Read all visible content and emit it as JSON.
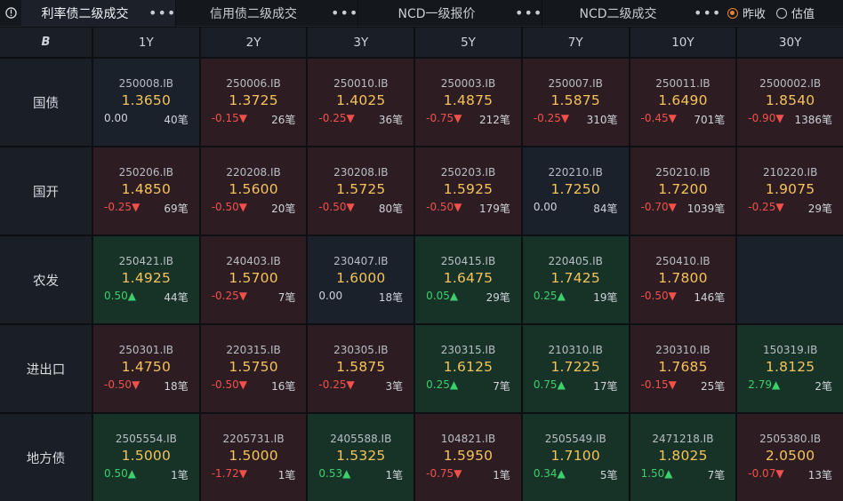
{
  "tabs": [
    {
      "label": "利率债二级成交",
      "active": true
    },
    {
      "label": "信用债二级成交",
      "active": false
    },
    {
      "label": "NCD一级报价",
      "active": false
    },
    {
      "label": "NCD二级成交",
      "active": false
    }
  ],
  "tab_menu_glyph": "•••",
  "radio": {
    "options": [
      {
        "label": "昨收",
        "checked": true
      },
      {
        "label": "估值",
        "checked": false
      }
    ]
  },
  "corner_icon": "B",
  "tenors": [
    "1Y",
    "2Y",
    "3Y",
    "5Y",
    "7Y",
    "10Y",
    "30Y"
  ],
  "rows": [
    {
      "label": "国债",
      "cells": [
        {
          "code": "250008.IB",
          "price": "1.3650",
          "change": "0.00",
          "trend": "neutral",
          "count": "40笔"
        },
        {
          "code": "250006.IB",
          "price": "1.3725",
          "change": "-0.15",
          "trend": "down",
          "count": "26笔"
        },
        {
          "code": "250010.IB",
          "price": "1.4025",
          "change": "-0.25",
          "trend": "down",
          "count": "36笔"
        },
        {
          "code": "250003.IB",
          "price": "1.4875",
          "change": "-0.75",
          "trend": "down",
          "count": "212笔"
        },
        {
          "code": "250007.IB",
          "price": "1.5875",
          "change": "-0.25",
          "trend": "down",
          "count": "310笔"
        },
        {
          "code": "250011.IB",
          "price": "1.6490",
          "change": "-0.45",
          "trend": "down",
          "count": "701笔"
        },
        {
          "code": "2500002.IB",
          "price": "1.8540",
          "change": "-0.90",
          "trend": "down",
          "count": "1386笔"
        }
      ]
    },
    {
      "label": "国开",
      "cells": [
        {
          "code": "250206.IB",
          "price": "1.4850",
          "change": "-0.25",
          "trend": "down",
          "count": "69笔"
        },
        {
          "code": "220208.IB",
          "price": "1.5600",
          "change": "-0.50",
          "trend": "down",
          "count": "20笔"
        },
        {
          "code": "230208.IB",
          "price": "1.5725",
          "change": "-0.50",
          "trend": "down",
          "count": "80笔"
        },
        {
          "code": "250203.IB",
          "price": "1.5925",
          "change": "-0.50",
          "trend": "down",
          "count": "179笔"
        },
        {
          "code": "220210.IB",
          "price": "1.7250",
          "change": "0.00",
          "trend": "neutral",
          "count": "84笔"
        },
        {
          "code": "250210.IB",
          "price": "1.7200",
          "change": "-0.70",
          "trend": "down",
          "count": "1039笔"
        },
        {
          "code": "210220.IB",
          "price": "1.9075",
          "change": "-0.25",
          "trend": "down",
          "count": "29笔"
        }
      ]
    },
    {
      "label": "农发",
      "cells": [
        {
          "code": "250421.IB",
          "price": "1.4925",
          "change": "0.50",
          "trend": "up",
          "count": "44笔"
        },
        {
          "code": "240403.IB",
          "price": "1.5700",
          "change": "-0.25",
          "trend": "down",
          "count": "7笔"
        },
        {
          "code": "230407.IB",
          "price": "1.6000",
          "change": "0.00",
          "trend": "neutral",
          "count": "18笔"
        },
        {
          "code": "250415.IB",
          "price": "1.6475",
          "change": "0.05",
          "trend": "up",
          "count": "29笔"
        },
        {
          "code": "220405.IB",
          "price": "1.7425",
          "change": "0.25",
          "trend": "up",
          "count": "19笔"
        },
        {
          "code": "250410.IB",
          "price": "1.7800",
          "change": "-0.50",
          "trend": "down",
          "count": "146笔"
        },
        null
      ]
    },
    {
      "label": "进出口",
      "cells": [
        {
          "code": "250301.IB",
          "price": "1.4750",
          "change": "-0.50",
          "trend": "down",
          "count": "18笔"
        },
        {
          "code": "220315.IB",
          "price": "1.5750",
          "change": "-0.50",
          "trend": "down",
          "count": "16笔"
        },
        {
          "code": "230305.IB",
          "price": "1.5875",
          "change": "-0.25",
          "trend": "down",
          "count": "3笔"
        },
        {
          "code": "230315.IB",
          "price": "1.6125",
          "change": "0.25",
          "trend": "up",
          "count": "7笔"
        },
        {
          "code": "210310.IB",
          "price": "1.7225",
          "change": "0.75",
          "trend": "up",
          "count": "17笔"
        },
        {
          "code": "230310.IB",
          "price": "1.7685",
          "change": "-0.15",
          "trend": "down",
          "count": "25笔"
        },
        {
          "code": "150319.IB",
          "price": "1.8125",
          "change": "2.79",
          "trend": "up",
          "count": "2笔"
        }
      ]
    },
    {
      "label": "地方债",
      "cells": [
        {
          "code": "2505554.IB",
          "price": "1.5000",
          "change": "0.50",
          "trend": "up",
          "count": "1笔"
        },
        {
          "code": "2205731.IB",
          "price": "1.5000",
          "change": "-1.72",
          "trend": "down",
          "count": "1笔"
        },
        {
          "code": "2405588.IB",
          "price": "1.5325",
          "change": "0.53",
          "trend": "up",
          "count": "1笔"
        },
        {
          "code": "104821.IB",
          "price": "1.5950",
          "change": "-0.75",
          "trend": "down",
          "count": "1笔"
        },
        {
          "code": "2505549.IB",
          "price": "1.7100",
          "change": "0.34",
          "trend": "up",
          "count": "5笔"
        },
        {
          "code": "2471218.IB",
          "price": "1.8025",
          "change": "1.50",
          "trend": "up",
          "count": "7笔"
        },
        {
          "code": "2505380.IB",
          "price": "2.0500",
          "change": "-0.07",
          "trend": "down",
          "count": "13笔"
        }
      ]
    }
  ],
  "colors": {
    "accent": "#e8852e",
    "price": "#f4c35a",
    "up": "#3ccf6c",
    "down": "#f1514a"
  }
}
